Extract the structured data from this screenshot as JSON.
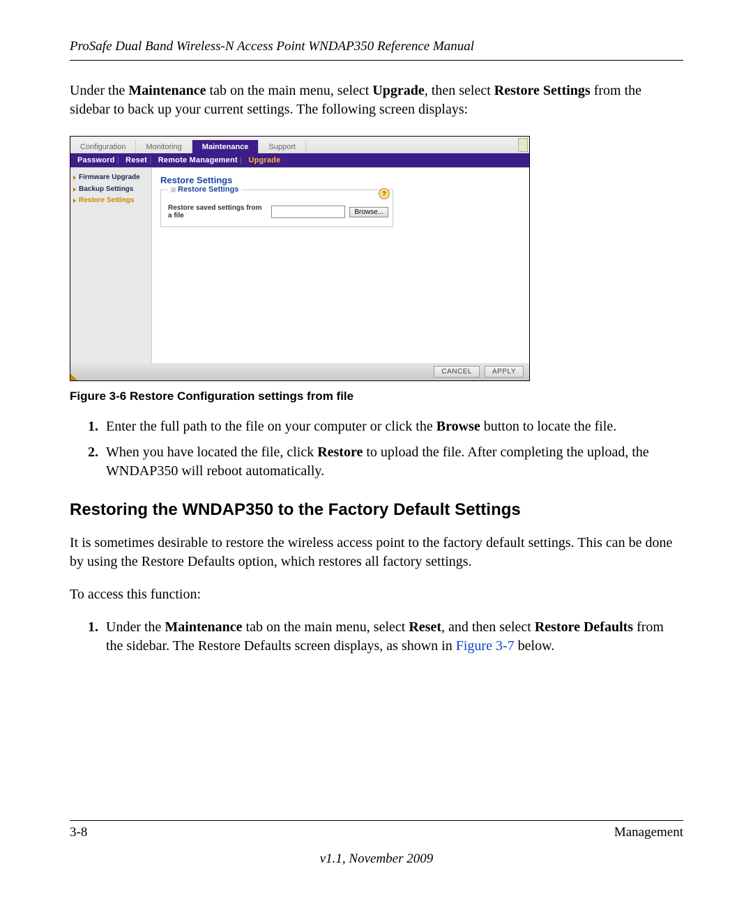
{
  "header": {
    "running_head": "ProSafe Dual Band Wireless-N Access Point WNDAP350 Reference Manual"
  },
  "intro": {
    "pre": "Under the ",
    "b1": "Maintenance",
    "mid1": " tab on the main menu, select ",
    "b2": "Upgrade",
    "mid2": ", then select ",
    "b3": "Restore Settings",
    "post": " from the sidebar to back up your current settings. The following screen displays:"
  },
  "screenshot": {
    "tabs": {
      "t0": "Configuration",
      "t1": "Monitoring",
      "t2": "Maintenance",
      "t3": "Support"
    },
    "subnav": {
      "s0": "Password",
      "s1": "Reset",
      "s2": "Remote Management",
      "s3": "Upgrade"
    },
    "sidebar": {
      "i0": "Firmware Upgrade",
      "i1": "Backup Settings",
      "i2": "Restore Settings"
    },
    "panel": {
      "title": "Restore Settings",
      "legend": "Restore Settings",
      "help_char": "?",
      "row_label": "Restore saved settings from a file",
      "browse": "Browse..."
    },
    "buttons": {
      "cancel": "CANCEL",
      "apply": "APPLY"
    }
  },
  "figure_caption": "Figure 3-6  Restore Configuration settings from file",
  "steps1": {
    "s1_pre": "Enter the full path to the file on your computer or click the ",
    "s1_b": "Browse",
    "s1_post": " button to locate the file.",
    "s2_pre": "When you have located the file, click ",
    "s2_b": "Restore",
    "s2_post": " to upload the file. After completing the upload, the WNDAP350 will reboot automatically."
  },
  "section_heading": "Restoring the WNDAP350 to the Factory Default Settings",
  "para2": "It is sometimes desirable to restore the wireless access point to the factory default settings. This can be done by using the Restore Defaults option, which restores all factory settings.",
  "para3": "To access this function:",
  "steps2": {
    "s1_pre": "Under the ",
    "s1_b1": "Maintenance",
    "s1_mid1": " tab on the main menu, select ",
    "s1_b2": "Reset",
    "s1_mid2": ", and then select ",
    "s1_b3": "Restore Defaults",
    "s1_mid3": " from the sidebar. The Restore Defaults screen displays, as shown in ",
    "s1_link": "Figure 3-7",
    "s1_post": " below."
  },
  "footer": {
    "left": "3-8",
    "right": "Management",
    "version": "v1.1, November 2009"
  }
}
